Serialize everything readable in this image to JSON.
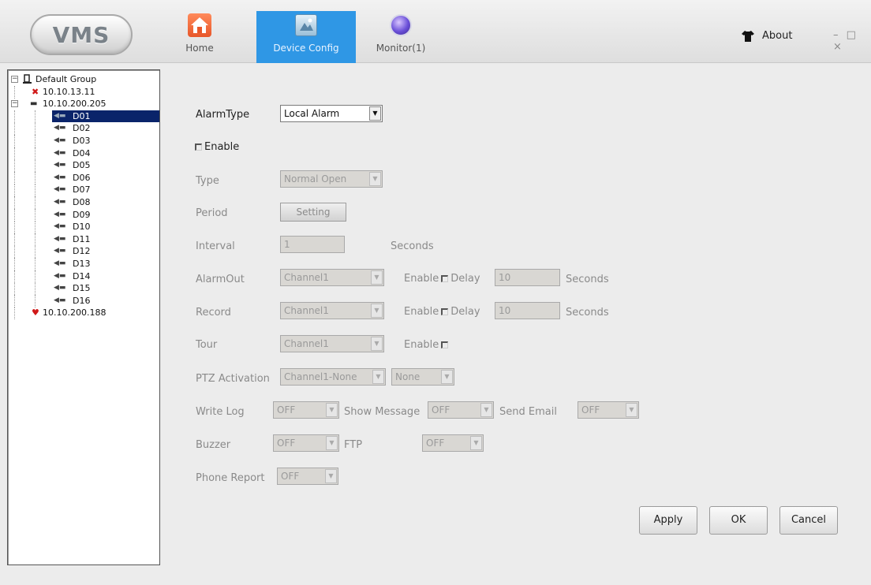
{
  "app": {
    "logo": "VMS",
    "nav": [
      {
        "label": "Home",
        "icon": "home-icon"
      },
      {
        "label": "Device Config",
        "icon": "device-config-icon"
      },
      {
        "label": "Monitor(1)",
        "icon": "monitor-icon"
      }
    ],
    "about": "About",
    "window_controls": "– □ ×",
    "accent": "#2f97e5"
  },
  "tree": {
    "root": "Default Group",
    "devices": [
      {
        "label": "10.10.13.11",
        "status": "offline"
      },
      {
        "label": "10.10.200.205",
        "status": "online"
      },
      {
        "label": "10.10.200.188",
        "status": "warning"
      }
    ],
    "channels": [
      "D01",
      "D02",
      "D03",
      "D04",
      "D05",
      "D06",
      "D07",
      "D08",
      "D09",
      "D10",
      "D11",
      "D12",
      "D13",
      "D14",
      "D15",
      "D16"
    ],
    "selected": "D01"
  },
  "form": {
    "alarm_type_label": "AlarmType",
    "alarm_type_value": "Local Alarm",
    "enable_label": "Enable",
    "type_label": "Type",
    "type_value": "Normal Open",
    "period_label": "Period",
    "period_button": "Setting",
    "interval_label": "Interval",
    "interval_value": "1",
    "seconds": "Seconds",
    "alarmout_label": "AlarmOut",
    "alarmout_value": "Channel1",
    "enable_text": "Enable",
    "delay_text": "Delay",
    "alarmout_delay": "10",
    "record_label": "Record",
    "record_value": "Channel1",
    "record_delay": "10",
    "tour_label": "Tour",
    "tour_value": "Channel1",
    "ptz_label": "PTZ Activation",
    "ptz_channel": "Channel1-None",
    "ptz_value": "None",
    "writelog_label": "Write Log",
    "writelog_value": "OFF",
    "showmsg_label": "Show Message",
    "showmsg_value": "OFF",
    "sendemail_label": "Send Email",
    "sendemail_value": "OFF",
    "buzzer_label": "Buzzer",
    "buzzer_value": "OFF",
    "ftp_label": "FTP",
    "ftp_value": "OFF",
    "phone_label": "Phone Report",
    "phone_value": "OFF"
  },
  "buttons": {
    "apply": "Apply",
    "ok": "OK",
    "cancel": "Cancel"
  }
}
